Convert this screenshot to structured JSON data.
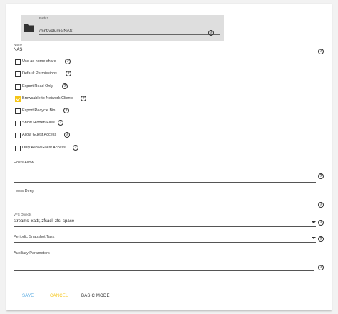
{
  "path": {
    "label": "Path *",
    "value": "/mnt/volume/NAS",
    "icon": "folder-icon"
  },
  "name": {
    "label": "Name",
    "value": "NAS"
  },
  "checkboxes": [
    {
      "label": "Use as home share",
      "checked": false
    },
    {
      "label": "Default Permissions",
      "checked": false
    },
    {
      "label": "Export Read Only",
      "checked": false
    },
    {
      "label": "Browsable to Network Clients",
      "checked": true
    },
    {
      "label": "Export Recycle Bin",
      "checked": false
    },
    {
      "label": "Show Hidden Files",
      "checked": false
    },
    {
      "label": "Allow Guest Access",
      "checked": false
    },
    {
      "label": "Only Allow Guest Access",
      "checked": false
    }
  ],
  "hosts_allow": {
    "label": "Hosts Allow",
    "value": ""
  },
  "hosts_deny": {
    "label": "Hosts Deny",
    "value": ""
  },
  "vfs_objects": {
    "label": "VFS Objects",
    "value": "streams_xattr, zfsacl, zfs_space"
  },
  "periodic_snapshot": {
    "label": "Periodic Snapshot Task",
    "value": ""
  },
  "aux_params": {
    "label": "Auxiliary Parameters",
    "value": ""
  },
  "help_glyph": "?",
  "buttons": {
    "save": "SAVE",
    "cancel": "CANCEL",
    "basic_mode": "BASIC MODE"
  },
  "colors": {
    "save": "#4aa3df",
    "cancel": "#f5c518",
    "basic_mode": "#333333",
    "accent": "#f5c518"
  }
}
